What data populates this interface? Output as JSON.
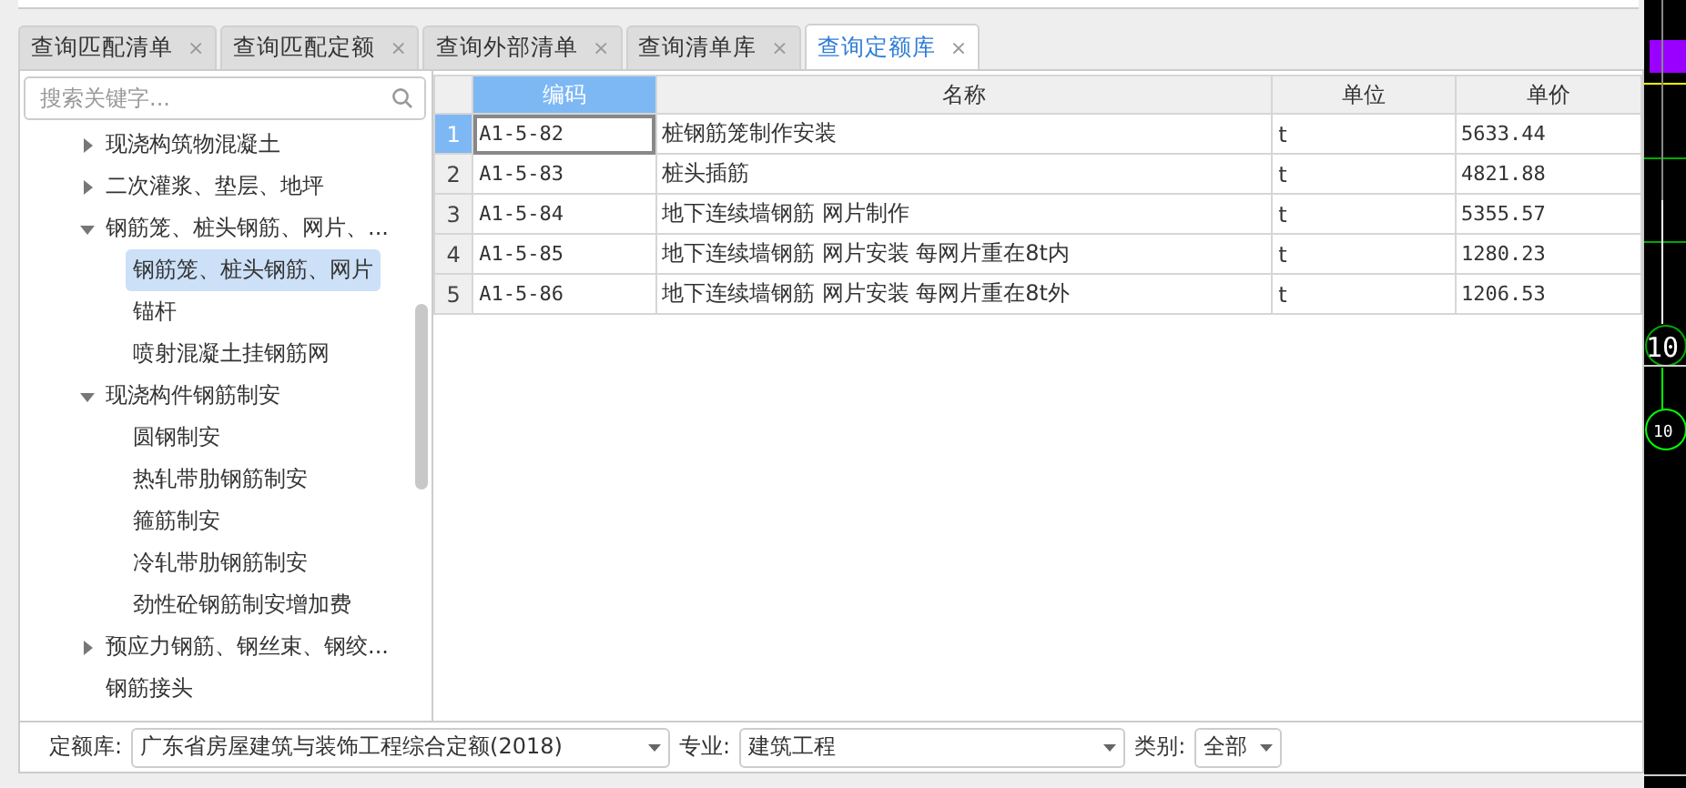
{
  "tabs": [
    {
      "label": "查询匹配清单",
      "selected": false
    },
    {
      "label": "查询匹配定额",
      "selected": false
    },
    {
      "label": "查询外部清单",
      "selected": false
    },
    {
      "label": "查询清单库",
      "selected": false
    },
    {
      "label": "查询定额库",
      "selected": true
    }
  ],
  "close_glyph": "×",
  "search": {
    "placeholder": "搜索关键字..."
  },
  "tree": [
    {
      "label": "现浇构筑物混凝土",
      "kind": "folder",
      "expanded": false
    },
    {
      "label": "二次灌浆、垫层、地坪",
      "kind": "folder",
      "expanded": false
    },
    {
      "label": "钢筋笼、桩头钢筋、网片、...",
      "kind": "folder",
      "expanded": true,
      "children": [
        {
          "label": "钢筋笼、桩头钢筋、网片",
          "selected": true
        },
        {
          "label": "锚杆",
          "selected": false
        },
        {
          "label": "喷射混凝土挂钢筋网",
          "selected": false
        }
      ]
    },
    {
      "label": "现浇构件钢筋制安",
      "kind": "folder",
      "expanded": true,
      "children": [
        {
          "label": "圆钢制安",
          "selected": false
        },
        {
          "label": "热轧带肋钢筋制安",
          "selected": false
        },
        {
          "label": "箍筋制安",
          "selected": false
        },
        {
          "label": "冷轧带肋钢筋制安",
          "selected": false
        },
        {
          "label": "劲性砼钢筋制安增加费",
          "selected": false
        }
      ]
    },
    {
      "label": "预应力钢筋、钢丝束、钢绞...",
      "kind": "folder",
      "expanded": false
    },
    {
      "label": "钢筋接头",
      "kind": "leaf"
    }
  ],
  "table": {
    "columns": [
      {
        "label": "编码",
        "selected": true
      },
      {
        "label": "名称",
        "selected": false
      },
      {
        "label": "单位",
        "selected": false
      },
      {
        "label": "单价",
        "selected": false
      }
    ],
    "rows": [
      {
        "index": "1",
        "selected": true,
        "cells": [
          "A1-5-82",
          "桩钢筋笼制作安装",
          "t",
          "5633.44"
        ]
      },
      {
        "index": "2",
        "selected": false,
        "cells": [
          "A1-5-83",
          "桩头插筋",
          "t",
          "4821.88"
        ]
      },
      {
        "index": "3",
        "selected": false,
        "cells": [
          "A1-5-84",
          "地下连续墙钢筋 网片制作",
          "t",
          "5355.57"
        ]
      },
      {
        "index": "4",
        "selected": false,
        "cells": [
          "A1-5-85",
          "地下连续墙钢筋 网片安装 每网片重在8t内",
          "t",
          "1280.23"
        ]
      },
      {
        "index": "5",
        "selected": false,
        "cells": [
          "A1-5-86",
          "地下连续墙钢筋 网片安装 每网片重在8t外",
          "t",
          "1206.53"
        ]
      }
    ]
  },
  "filters": [
    {
      "label": "定额库:",
      "value": "广东省房屋建筑与装饰工程综合定额(2018)"
    },
    {
      "label": "专业:",
      "value": "建筑工程"
    },
    {
      "label": "类别:",
      "value": "全部"
    }
  ],
  "cad_labels": [
    "10",
    "10"
  ]
}
